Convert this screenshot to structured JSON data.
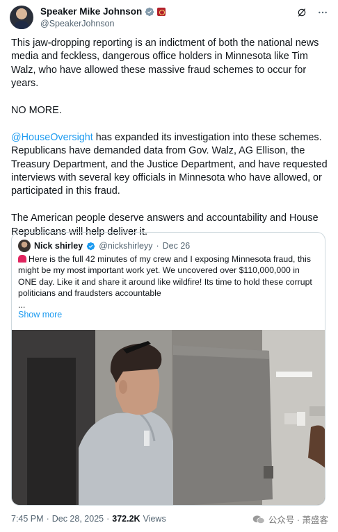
{
  "author": {
    "name": "Speaker Mike Johnson",
    "handle": "@SpeakerJohnson",
    "verified": true,
    "badge_color": "#b3202a"
  },
  "header_icons": [
    "grok-icon",
    "more-icon"
  ],
  "tweet": {
    "p1": "This jaw-dropping reporting is an indictment of both the national news media and feckless, dangerous office holders in Minnesota like Tim Walz, who have allowed these massive fraud schemes to occur for years.",
    "p2": "NO MORE.",
    "p3_mention": "@HouseOversight",
    "p3_rest": " has expanded its investigation into these schemes. Republicans have demanded data from Gov. Walz, AG Ellison, the Treasury Department, and the Justice Department, and have requested interviews with several key officials in Minnesota who have allowed, or participated in this fraud.",
    "p4": "The American people deserve answers and accountability and House Republicans will help deliver it."
  },
  "quote": {
    "name": "Nick shirley",
    "handle": "@nickshirleyy",
    "separator": "·",
    "date": "Dec 26",
    "text": "Here is the full 42 minutes of my crew and I exposing Minnesota fraud, this might be my most important work yet. We uncovered over $110,000,000 in ONE day. Like it and share it around like wildfire! Its time to hold these corrupt politicians and fraudsters accountable\n...",
    "show_more": "Show more"
  },
  "footer": {
    "time": "7:45 PM",
    "sep1": "·",
    "date": "Dec 28, 2025",
    "sep2": "·",
    "views_count": "372.2K",
    "views_label": "Views"
  },
  "watermark": "公众号 · 萧盛客",
  "colors": {
    "accent": "#1d9bf0",
    "text": "#0f1419",
    "secondary": "#536471",
    "border": "#cfd9de"
  }
}
